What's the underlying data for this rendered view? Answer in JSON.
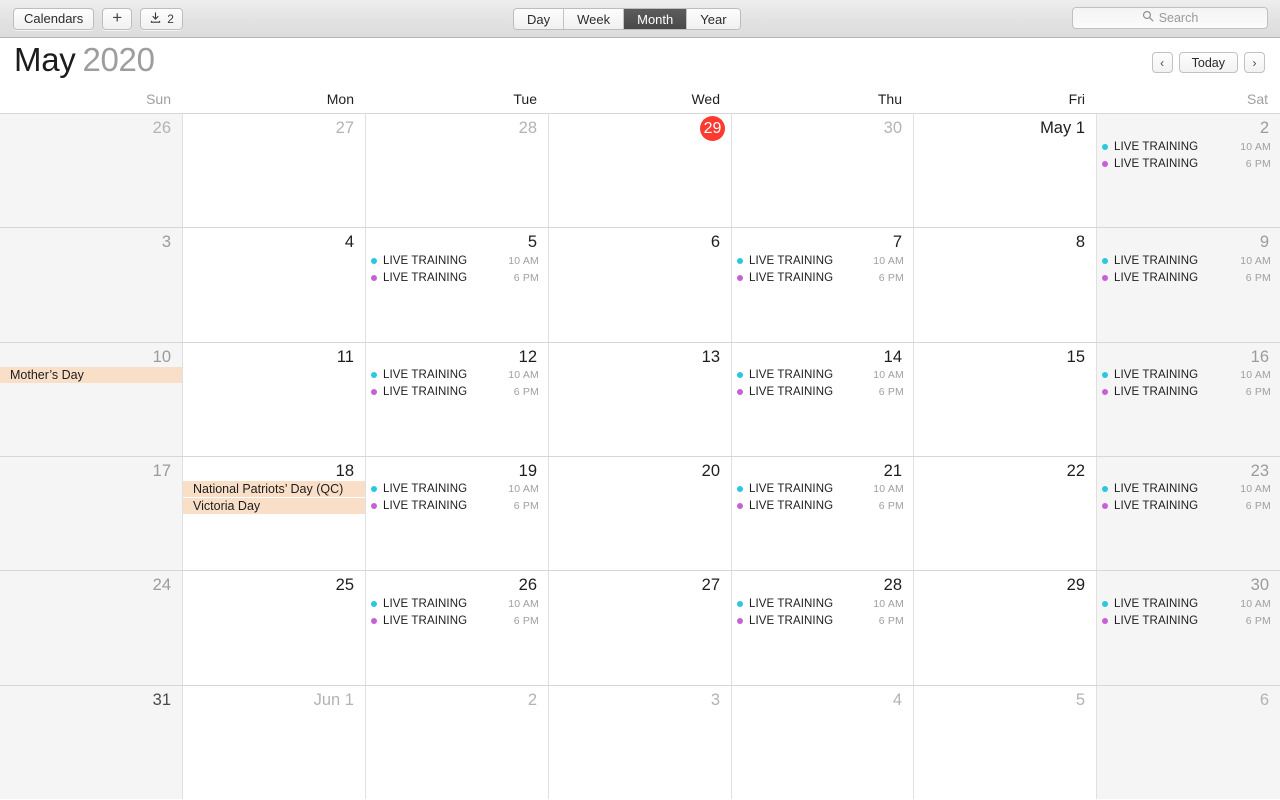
{
  "toolbar": {
    "calendars_label": "Calendars",
    "add_label": "+",
    "add_icon": "plus-icon",
    "inbox_icon": "download-inbox-icon",
    "inbox_count": "2",
    "view_options": [
      {
        "label": "Day",
        "active": false
      },
      {
        "label": "Week",
        "active": false
      },
      {
        "label": "Month",
        "active": true
      },
      {
        "label": "Year",
        "active": false
      }
    ],
    "search": {
      "icon": "search-icon",
      "placeholder": "Search",
      "value": ""
    }
  },
  "header": {
    "month": "May",
    "year": "2020",
    "prev_label": "‹",
    "today_label": "Today",
    "next_label": "›"
  },
  "weekdays": [
    {
      "label": "Sun",
      "weekend": true
    },
    {
      "label": "Mon",
      "weekend": false
    },
    {
      "label": "Tue",
      "weekend": false
    },
    {
      "label": "Wed",
      "weekend": false
    },
    {
      "label": "Thu",
      "weekend": false
    },
    {
      "label": "Fri",
      "weekend": false
    },
    {
      "label": "Sat",
      "weekend": true
    }
  ],
  "colors": {
    "event_dot_cyan": "#29c7e0",
    "event_dot_purple": "#c95fd8",
    "today_badge": "#fb3b30",
    "holiday_banner": "#fadfc8",
    "weekend_cell": "#f5f5f5",
    "active_segment": "#4e4e4e"
  },
  "weeks": [
    {
      "days": [
        {
          "num": "26",
          "in_month": false,
          "weekend": true,
          "today": false,
          "holidays": [],
          "events": []
        },
        {
          "num": "27",
          "in_month": false,
          "weekend": false,
          "today": false,
          "holidays": [],
          "events": []
        },
        {
          "num": "28",
          "in_month": false,
          "weekend": false,
          "today": false,
          "holidays": [],
          "events": []
        },
        {
          "num": "29",
          "in_month": false,
          "weekend": false,
          "today": true,
          "holidays": [],
          "events": []
        },
        {
          "num": "30",
          "in_month": false,
          "weekend": false,
          "today": false,
          "holidays": [],
          "events": []
        },
        {
          "num": "May 1",
          "in_month": true,
          "weekend": false,
          "today": false,
          "holidays": [],
          "events": []
        },
        {
          "num": "2",
          "in_month": true,
          "weekend": true,
          "today": false,
          "holidays": [],
          "events": [
            {
              "title": "LIVE TRAINING",
              "time": "10 AM",
              "color": "#29c7e0"
            },
            {
              "title": "LIVE TRAINING",
              "time": "6 PM",
              "color": "#c95fd8"
            }
          ]
        }
      ]
    },
    {
      "days": [
        {
          "num": "3",
          "in_month": true,
          "weekend": true,
          "today": false,
          "holidays": [],
          "events": []
        },
        {
          "num": "4",
          "in_month": true,
          "weekend": false,
          "today": false,
          "holidays": [],
          "events": []
        },
        {
          "num": "5",
          "in_month": true,
          "weekend": false,
          "today": false,
          "holidays": [],
          "events": [
            {
              "title": "LIVE TRAINING",
              "time": "10 AM",
              "color": "#29c7e0"
            },
            {
              "title": "LIVE TRAINING",
              "time": "6 PM",
              "color": "#c95fd8"
            }
          ]
        },
        {
          "num": "6",
          "in_month": true,
          "weekend": false,
          "today": false,
          "holidays": [],
          "events": []
        },
        {
          "num": "7",
          "in_month": true,
          "weekend": false,
          "today": false,
          "holidays": [],
          "events": [
            {
              "title": "LIVE TRAINING",
              "time": "10 AM",
              "color": "#29c7e0"
            },
            {
              "title": "LIVE TRAINING",
              "time": "6 PM",
              "color": "#c95fd8"
            }
          ]
        },
        {
          "num": "8",
          "in_month": true,
          "weekend": false,
          "today": false,
          "holidays": [],
          "events": []
        },
        {
          "num": "9",
          "in_month": true,
          "weekend": true,
          "today": false,
          "holidays": [],
          "events": [
            {
              "title": "LIVE TRAINING",
              "time": "10 AM",
              "color": "#29c7e0"
            },
            {
              "title": "LIVE TRAINING",
              "time": "6 PM",
              "color": "#c95fd8"
            }
          ]
        }
      ]
    },
    {
      "days": [
        {
          "num": "10",
          "in_month": true,
          "weekend": true,
          "today": false,
          "holidays": [
            "Mother’s Day"
          ],
          "events": []
        },
        {
          "num": "11",
          "in_month": true,
          "weekend": false,
          "today": false,
          "holidays": [],
          "events": []
        },
        {
          "num": "12",
          "in_month": true,
          "weekend": false,
          "today": false,
          "holidays": [],
          "events": [
            {
              "title": "LIVE TRAINING",
              "time": "10 AM",
              "color": "#29c7e0"
            },
            {
              "title": "LIVE TRAINING",
              "time": "6 PM",
              "color": "#c95fd8"
            }
          ]
        },
        {
          "num": "13",
          "in_month": true,
          "weekend": false,
          "today": false,
          "holidays": [],
          "events": []
        },
        {
          "num": "14",
          "in_month": true,
          "weekend": false,
          "today": false,
          "holidays": [],
          "events": [
            {
              "title": "LIVE TRAINING",
              "time": "10 AM",
              "color": "#29c7e0"
            },
            {
              "title": "LIVE TRAINING",
              "time": "6 PM",
              "color": "#c95fd8"
            }
          ]
        },
        {
          "num": "15",
          "in_month": true,
          "weekend": false,
          "today": false,
          "holidays": [],
          "events": []
        },
        {
          "num": "16",
          "in_month": true,
          "weekend": true,
          "today": false,
          "holidays": [],
          "events": [
            {
              "title": "LIVE TRAINING",
              "time": "10 AM",
              "color": "#29c7e0"
            },
            {
              "title": "LIVE TRAINING",
              "time": "6 PM",
              "color": "#c95fd8"
            }
          ]
        }
      ]
    },
    {
      "days": [
        {
          "num": "17",
          "in_month": true,
          "weekend": true,
          "today": false,
          "holidays": [],
          "events": []
        },
        {
          "num": "18",
          "in_month": true,
          "weekend": false,
          "today": false,
          "holidays": [
            "National Patriots’ Day (QC)",
            "Victoria Day"
          ],
          "events": []
        },
        {
          "num": "19",
          "in_month": true,
          "weekend": false,
          "today": false,
          "holidays": [],
          "events": [
            {
              "title": "LIVE TRAINING",
              "time": "10 AM",
              "color": "#29c7e0"
            },
            {
              "title": "LIVE TRAINING",
              "time": "6 PM",
              "color": "#c95fd8"
            }
          ]
        },
        {
          "num": "20",
          "in_month": true,
          "weekend": false,
          "today": false,
          "holidays": [],
          "events": []
        },
        {
          "num": "21",
          "in_month": true,
          "weekend": false,
          "today": false,
          "holidays": [],
          "events": [
            {
              "title": "LIVE TRAINING",
              "time": "10 AM",
              "color": "#29c7e0"
            },
            {
              "title": "LIVE TRAINING",
              "time": "6 PM",
              "color": "#c95fd8"
            }
          ]
        },
        {
          "num": "22",
          "in_month": true,
          "weekend": false,
          "today": false,
          "holidays": [],
          "events": []
        },
        {
          "num": "23",
          "in_month": true,
          "weekend": true,
          "today": false,
          "holidays": [],
          "events": [
            {
              "title": "LIVE TRAINING",
              "time": "10 AM",
              "color": "#29c7e0"
            },
            {
              "title": "LIVE TRAINING",
              "time": "6 PM",
              "color": "#c95fd8"
            }
          ]
        }
      ]
    },
    {
      "days": [
        {
          "num": "24",
          "in_month": true,
          "weekend": true,
          "today": false,
          "holidays": [],
          "events": []
        },
        {
          "num": "25",
          "in_month": true,
          "weekend": false,
          "today": false,
          "holidays": [],
          "events": []
        },
        {
          "num": "26",
          "in_month": true,
          "weekend": false,
          "today": false,
          "holidays": [],
          "events": [
            {
              "title": "LIVE TRAINING",
              "time": "10 AM",
              "color": "#29c7e0"
            },
            {
              "title": "LIVE TRAINING",
              "time": "6 PM",
              "color": "#c95fd8"
            }
          ]
        },
        {
          "num": "27",
          "in_month": true,
          "weekend": false,
          "today": false,
          "holidays": [],
          "events": []
        },
        {
          "num": "28",
          "in_month": true,
          "weekend": false,
          "today": false,
          "holidays": [],
          "events": [
            {
              "title": "LIVE TRAINING",
              "time": "10 AM",
              "color": "#29c7e0"
            },
            {
              "title": "LIVE TRAINING",
              "time": "6 PM",
              "color": "#c95fd8"
            }
          ]
        },
        {
          "num": "29",
          "in_month": true,
          "weekend": false,
          "today": false,
          "holidays": [],
          "events": []
        },
        {
          "num": "30",
          "in_month": true,
          "weekend": true,
          "today": false,
          "holidays": [],
          "events": [
            {
              "title": "LIVE TRAINING",
              "time": "10 AM",
              "color": "#29c7e0"
            },
            {
              "title": "LIVE TRAINING",
              "time": "6 PM",
              "color": "#c95fd8"
            }
          ]
        }
      ]
    },
    {
      "days": [
        {
          "num": "31",
          "in_month": true,
          "weekend": true,
          "today": false,
          "holidays": [],
          "events": [],
          "emphasize": true
        },
        {
          "num": "Jun 1",
          "in_month": false,
          "weekend": false,
          "today": false,
          "holidays": [],
          "events": []
        },
        {
          "num": "2",
          "in_month": false,
          "weekend": false,
          "today": false,
          "holidays": [],
          "events": []
        },
        {
          "num": "3",
          "in_month": false,
          "weekend": false,
          "today": false,
          "holidays": [],
          "events": []
        },
        {
          "num": "4",
          "in_month": false,
          "weekend": false,
          "today": false,
          "holidays": [],
          "events": []
        },
        {
          "num": "5",
          "in_month": false,
          "weekend": false,
          "today": false,
          "holidays": [],
          "events": []
        },
        {
          "num": "6",
          "in_month": false,
          "weekend": true,
          "today": false,
          "holidays": [],
          "events": []
        }
      ]
    }
  ]
}
